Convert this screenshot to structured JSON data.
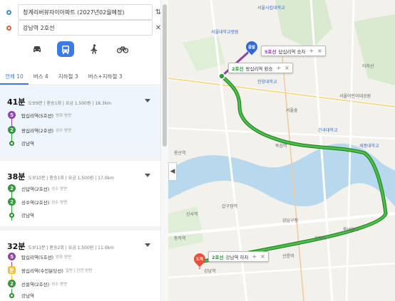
{
  "search": {
    "origin": "청계리버뷰자이아파트 (2027년02월예정)",
    "destination": "강남역 2호선",
    "swap_icon": "swap-icon",
    "clear_icon": "close-icon"
  },
  "modes": [
    {
      "name": "car",
      "icon": "car-icon",
      "active": false
    },
    {
      "name": "transit",
      "icon": "bus-icon",
      "active": true
    },
    {
      "name": "walk",
      "icon": "walk-icon",
      "active": false
    },
    {
      "name": "bike",
      "icon": "bike-icon",
      "active": false
    }
  ],
  "tabs": [
    "전체 10",
    "버스 4",
    "지하철 3",
    "버스+지하철 3"
  ],
  "routes": [
    {
      "time": "41분",
      "info": "도보9분 | 환승1회 | 요금 1,500원 | 18.3km",
      "steps": [
        {
          "badge": "5",
          "color": "#8e44ad",
          "name": "탑십리역(5호선)",
          "sub": "방화 방면"
        },
        {
          "badge": "2",
          "color": "#2e9a3a",
          "name": "왕십리역(2호선)",
          "sub": "성수 방면"
        },
        {
          "badge": "",
          "color": "",
          "name": "강남역",
          "sub": ""
        }
      ]
    },
    {
      "time": "38분",
      "info": "도보10분 | 환승1회 | 요금 1,500원 | 17.0km",
      "steps": [
        {
          "badge": "2",
          "color": "#2e9a3a",
          "name": "신답역(2호선)",
          "sub": "성수 방면"
        },
        {
          "badge": "2",
          "color": "#2e9a3a",
          "name": "성수역(2호선)",
          "sub": "성수 방면"
        },
        {
          "badge": "",
          "color": "",
          "name": "강남역",
          "sub": ""
        }
      ]
    },
    {
      "time": "32분",
      "info": "도보13분 | 환승2회 | 요금 1,500원 | 11.0km",
      "steps": [
        {
          "badge": "5",
          "color": "#8e44ad",
          "name": "탑십리역(5호선)",
          "sub": "방화 방면"
        },
        {
          "badge": "분",
          "color": "#f2c12e",
          "name": "왕십리역(수인분당선)",
          "sub": "일반 | 인천 방면"
        },
        {
          "badge": "2",
          "color": "#2e9a3a",
          "name": "선릉역(2호선)",
          "sub": "성수 방면"
        },
        {
          "badge": "",
          "color": "",
          "name": "강남역",
          "sub": ""
        }
      ]
    }
  ],
  "map": {
    "callouts": {
      "board": {
        "line": "5호선",
        "text": "답십리역 승차"
      },
      "transfer": {
        "line": "2호선",
        "text": "왕십리역 환승"
      },
      "alight": {
        "line": "2호선",
        "text": "강남역 하차"
      }
    },
    "pins": {
      "start": "출발",
      "end": "도착"
    },
    "labels": [
      "서울시립대학교",
      "서울대학교병원",
      "한양대학교",
      "서울숲",
      "건국대학교",
      "서울어린이대공원",
      "아차산",
      "롯데월드",
      "강남구청",
      "코엑스",
      "선릉역",
      "강남역",
      "세종대학교",
      "신사역",
      "압구정역",
      "뚝섬역",
      "용산역",
      "동작역"
    ],
    "route_color": "#3fb83f",
    "transit_line_color": "#8e44ad"
  }
}
